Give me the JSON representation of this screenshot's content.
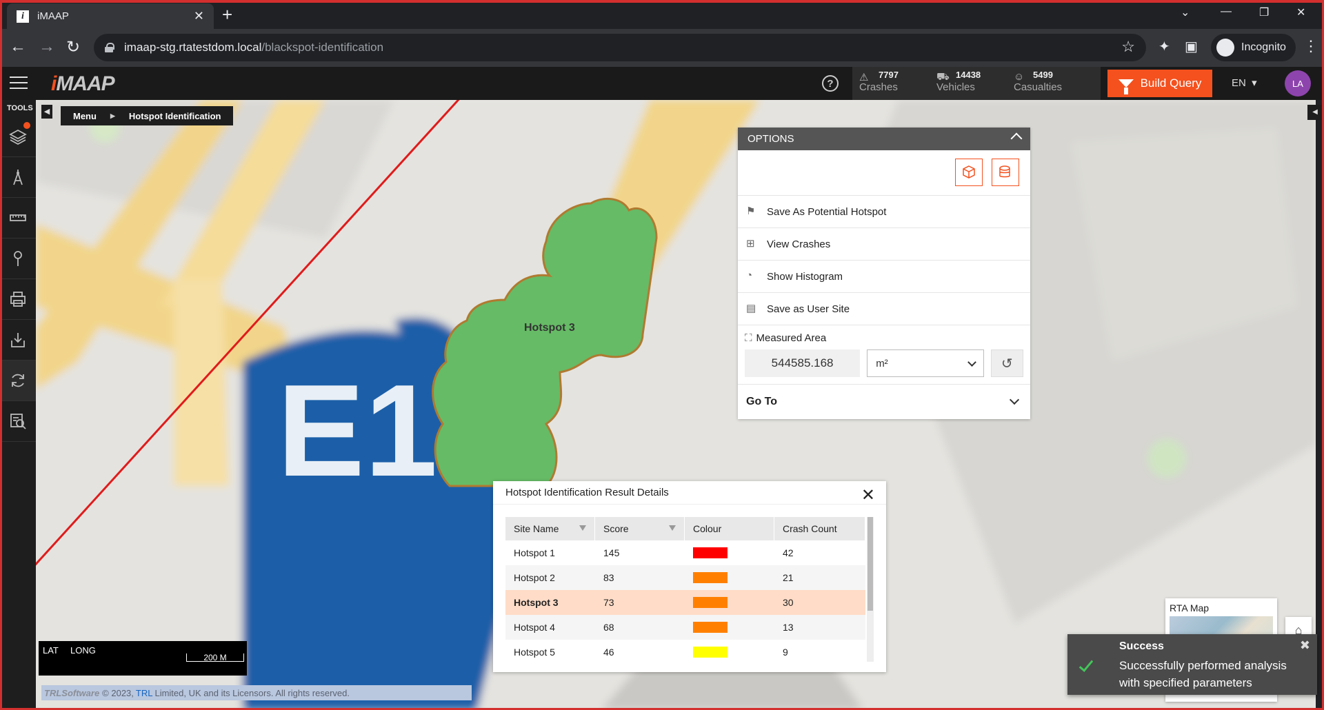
{
  "browser": {
    "tab_title": "iMAAP",
    "tab_icon_letter": "i",
    "url_host": "imaap-stg.rtatestdom.local",
    "url_path": "/blackspot-identification",
    "profile_label": "Incognito"
  },
  "app": {
    "logo_text": "MAAP",
    "logo_prefix": "i",
    "stats": [
      {
        "icon": "crash-icon",
        "value": "7797",
        "label": "Crashes"
      },
      {
        "icon": "vehicle-icon",
        "value": "14438",
        "label": "Vehicles"
      },
      {
        "icon": "person-icon",
        "value": "5499",
        "label": "Casualties"
      }
    ],
    "build_query_label": "Build Query",
    "language": "EN",
    "user_initials": "LA",
    "accent_color": "#f4511e"
  },
  "tools": {
    "header": "TOOLS",
    "items": [
      "layers-icon",
      "draw-icon",
      "ruler-icon",
      "pin-icon",
      "print-icon",
      "download-icon",
      "refresh-icon",
      "analysis-icon"
    ]
  },
  "breadcrumb": {
    "items": [
      "Menu",
      "Hotspot Identification"
    ]
  },
  "map": {
    "hotspot_label": "Hotspot 3",
    "road_sign_text": "E1"
  },
  "options": {
    "title": "OPTIONS",
    "rows": [
      {
        "icon": "save-hotspot-icon",
        "label": "Save As Potential Hotspot"
      },
      {
        "icon": "view-crashes-icon",
        "label": "View Crashes"
      },
      {
        "icon": "histogram-icon",
        "label": "Show Histogram"
      },
      {
        "icon": "user-site-icon",
        "label": "Save as User Site"
      }
    ],
    "measured_area": {
      "label": "Measured Area",
      "value": "544585.168",
      "unit": "m²"
    },
    "goto_label": "Go To"
  },
  "results": {
    "title": "Hotspot Identification Result Details",
    "columns": [
      "Site Name",
      "Score",
      "Colour",
      "Crash Count"
    ],
    "rows": [
      {
        "site": "Hotspot 1",
        "score": "145",
        "colour": "#ff0000",
        "crashes": "42"
      },
      {
        "site": "Hotspot 2",
        "score": "83",
        "colour": "#ff8000",
        "crashes": "21"
      },
      {
        "site": "Hotspot 3",
        "score": "73",
        "colour": "#ff8000",
        "crashes": "30",
        "selected": true
      },
      {
        "site": "Hotspot 4",
        "score": "68",
        "colour": "#ff8000",
        "crashes": "13"
      },
      {
        "site": "Hotspot 5",
        "score": "46",
        "colour": "#ffff00",
        "crashes": "9"
      }
    ]
  },
  "coords": {
    "lat_label": "LAT",
    "long_label": "LONG",
    "scale": "200 M"
  },
  "footer": {
    "brand": "TRLSoftware",
    "copyright_prefix": "© 2023,",
    "trl": "TRL",
    "copyright_suffix": "Limited, UK and its Licensors. All rights reserved."
  },
  "rta": {
    "label": "RTA Map"
  },
  "toast": {
    "title": "Success",
    "message": "Successfully performed analysis with specified parameters"
  }
}
